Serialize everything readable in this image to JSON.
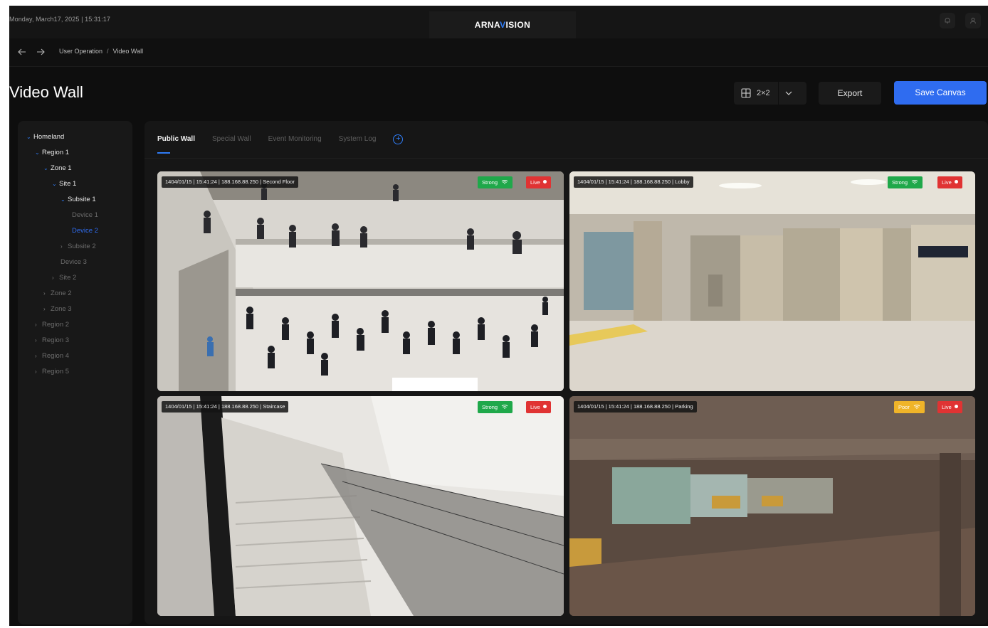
{
  "header": {
    "datetime": "Monday, March17, 2025  |  15:31:17",
    "brand_prefix": "ARNA",
    "brand_accent": "V",
    "brand_suffix": "ISION",
    "accent_color": "#2f7cf6"
  },
  "breadcrumb": {
    "back_icon": "arrow-left-icon",
    "forward_icon": "arrow-right-icon",
    "items": [
      "User Operation",
      "Video Wall"
    ],
    "separator": "/"
  },
  "page": {
    "title": "Video Wall",
    "layout_value": "2×2",
    "export_label": "Export",
    "save_label": "Save Canvas"
  },
  "tree": [
    {
      "label": "Homeland",
      "state": "expanded",
      "color": "#e6e6e6"
    },
    {
      "label": "Region 1",
      "state": "expanded",
      "color": "#e6e6e6"
    },
    {
      "label": "Zone 1",
      "state": "expanded",
      "color": "#e6e6e6"
    },
    {
      "label": "Site 1",
      "state": "expanded",
      "color": "#e6e6e6"
    },
    {
      "label": "Subsite 1",
      "state": "expanded",
      "color": "#e6e6e6"
    },
    {
      "label": "Device 1",
      "state": "leaf",
      "color": "#6c6c6c"
    },
    {
      "label": "Device 2",
      "state": "leaf",
      "color": "#2f6cf0"
    },
    {
      "label": "Subsite 2",
      "state": "collapsed",
      "color": "#6c6c6c"
    },
    {
      "label": "Device 3",
      "state": "leaf",
      "color": "#6c6c6c"
    },
    {
      "label": "Site 2",
      "state": "collapsed",
      "color": "#6c6c6c"
    },
    {
      "label": "Zone 2",
      "state": "collapsed",
      "color": "#6c6c6c"
    },
    {
      "label": "Zone 3",
      "state": "collapsed",
      "color": "#6c6c6c"
    },
    {
      "label": "Region 2",
      "state": "collapsed",
      "color": "#6c6c6c"
    },
    {
      "label": "Region 3",
      "state": "collapsed",
      "color": "#6c6c6c"
    },
    {
      "label": "Region 4",
      "state": "collapsed",
      "color": "#6c6c6c"
    },
    {
      "label": "Region 5",
      "state": "collapsed",
      "color": "#6c6c6c"
    }
  ],
  "tabs": [
    "Public Wall",
    "Special Wall",
    "Event Monitoring",
    "System Log"
  ],
  "active_tab": "Public Wall",
  "cameras": [
    {
      "info": "1404/01/15 | 15:41:24 | 188.168.88.250 | Second Floor",
      "signal": "Strong",
      "signal_level": "strong",
      "live": "Live"
    },
    {
      "info": "1404/01/15 | 15:41:24 | 188.168.88.250 | Lobby",
      "signal": "Strong",
      "signal_level": "strong",
      "live": "Live"
    },
    {
      "info": "1404/01/15 | 15:41:24 | 188.168.88.250 | Staircase",
      "signal": "Strong",
      "signal_level": "strong",
      "live": "Live"
    },
    {
      "info": "1404/01/15 | 15:41:24 | 188.168.88.250 | Parking",
      "signal": "Poor",
      "signal_level": "poor",
      "live": "Live"
    }
  ],
  "status_colors": {
    "strong": "#1fa84a",
    "poor": "#f0b429",
    "live": "#e03333"
  }
}
